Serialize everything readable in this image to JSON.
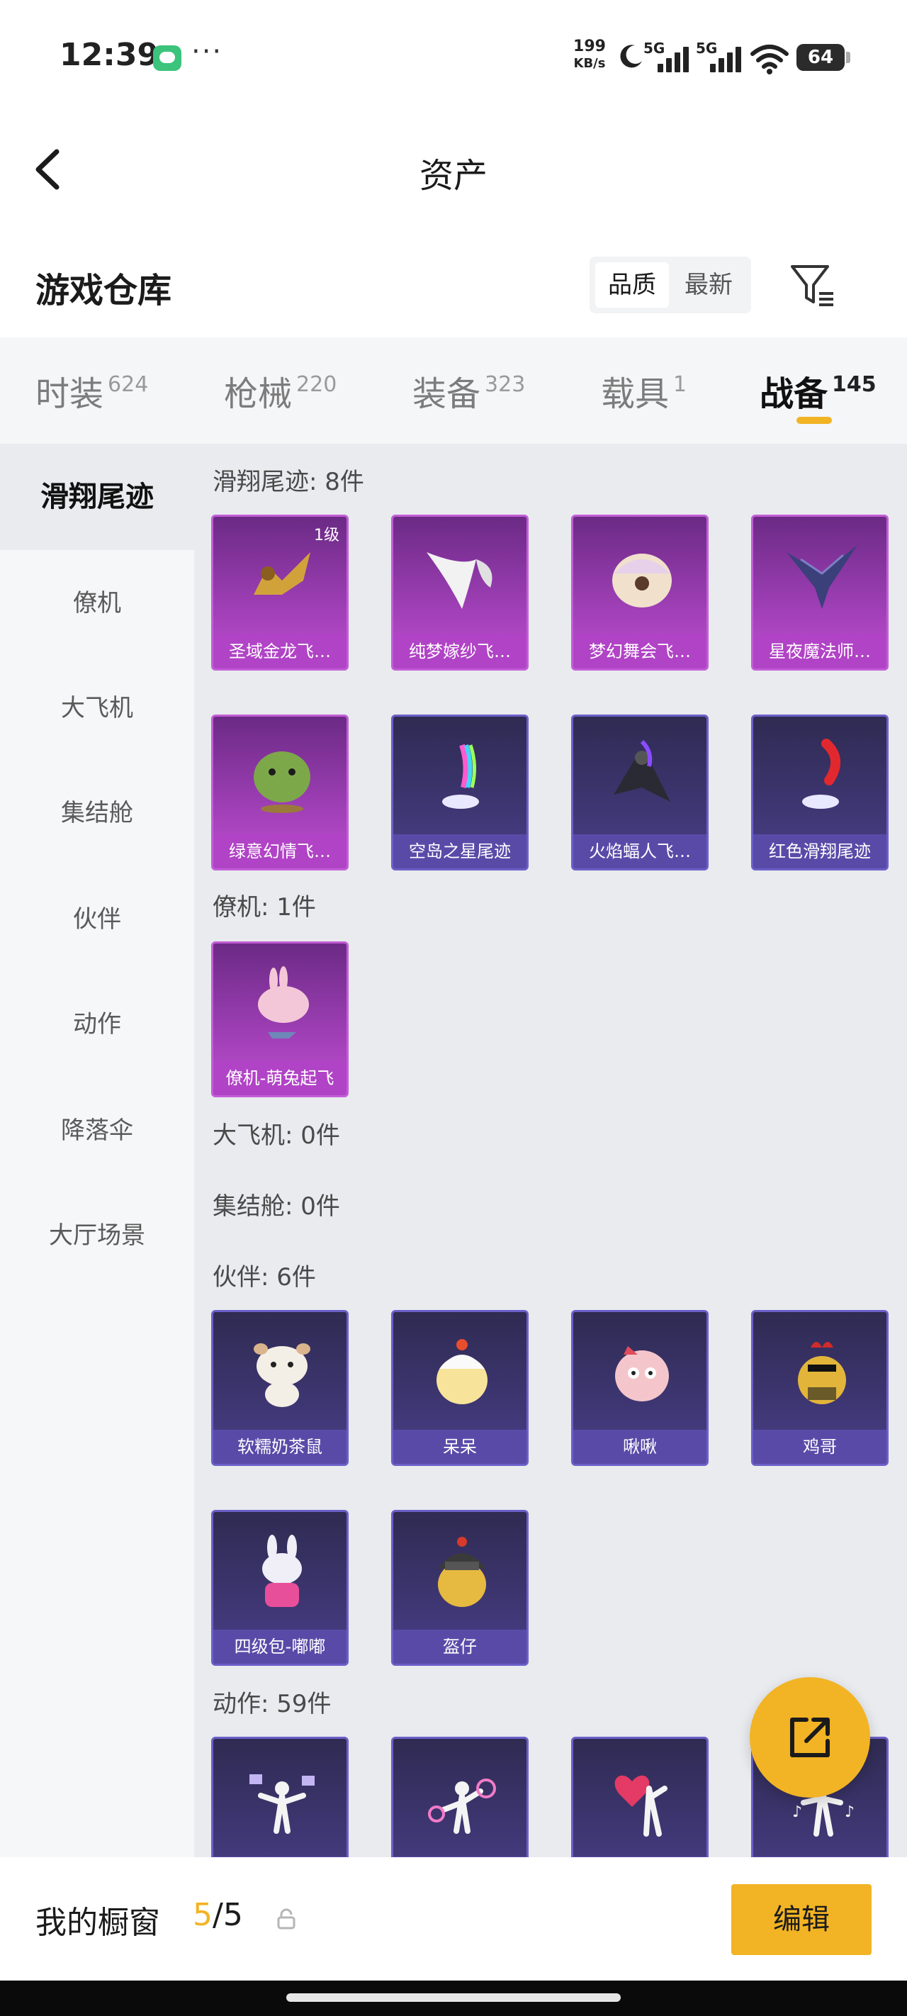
{
  "status_bar": {
    "time": "12:39",
    "more": "···",
    "net_speed_value": "199",
    "net_speed_unit": "KB/s",
    "signal1_label": "5G",
    "signal2_label": "5G",
    "battery": "64"
  },
  "header": {
    "title": "资产"
  },
  "warehouse": {
    "title": "游戏仓库",
    "sort_options": [
      "品质",
      "最新"
    ],
    "sort_selected": "品质"
  },
  "tabs": [
    {
      "label": "时装",
      "count": "624"
    },
    {
      "label": "枪械",
      "count": "220"
    },
    {
      "label": "装备",
      "count": "323"
    },
    {
      "label": "载具",
      "count": "1"
    },
    {
      "label": "战备",
      "count": "145",
      "active": true
    }
  ],
  "sidebar": {
    "items": [
      "滑翔尾迹",
      "僚机",
      "大飞机",
      "集结舱",
      "伙伴",
      "动作",
      "降落伞",
      "大厅场景"
    ],
    "active": "滑翔尾迹"
  },
  "sections": [
    {
      "title": "滑翔尾迹: 8件",
      "items": [
        {
          "name": "圣域金龙飞…",
          "level": "1级",
          "rarity": "epic"
        },
        {
          "name": "纯梦嫁纱飞…",
          "rarity": "epic"
        },
        {
          "name": "梦幻舞会飞…",
          "rarity": "epic"
        },
        {
          "name": "星夜魔法师…",
          "rarity": "epic"
        },
        {
          "name": "绿意幻情飞…",
          "rarity": "epic"
        },
        {
          "name": "空岛之星尾迹",
          "rarity": "rare"
        },
        {
          "name": "火焰蝠人飞…",
          "rarity": "rare"
        },
        {
          "name": "红色滑翔尾迹",
          "rarity": "rare"
        }
      ]
    },
    {
      "title": "僚机: 1件",
      "items": [
        {
          "name": "僚机-萌兔起飞",
          "rarity": "epic"
        }
      ]
    },
    {
      "title": "大飞机: 0件",
      "items": []
    },
    {
      "title": "集结舱: 0件",
      "items": []
    },
    {
      "title": "伙伴: 6件",
      "items": [
        {
          "name": "软糯奶茶鼠",
          "rarity": "rare"
        },
        {
          "name": "呆呆",
          "rarity": "rare"
        },
        {
          "name": "啾啾",
          "rarity": "rare"
        },
        {
          "name": "鸡哥",
          "rarity": "rare"
        },
        {
          "name": "四级包-嘟嘟",
          "rarity": "rare"
        },
        {
          "name": "盔仔",
          "rarity": "rare"
        }
      ]
    },
    {
      "title": "动作: 59件",
      "items": [
        {
          "name": "",
          "rarity": "rare"
        },
        {
          "name": "",
          "rarity": "rare"
        },
        {
          "name": "",
          "rarity": "rare"
        },
        {
          "name": "",
          "rarity": "rare"
        }
      ]
    }
  ],
  "showcase": {
    "label": "我的橱窗",
    "current": "5",
    "total": "/5",
    "edit_label": "编辑"
  },
  "colors": {
    "accent": "#f2b424",
    "epic": "#b143c6",
    "rare": "#5a4aa8"
  }
}
